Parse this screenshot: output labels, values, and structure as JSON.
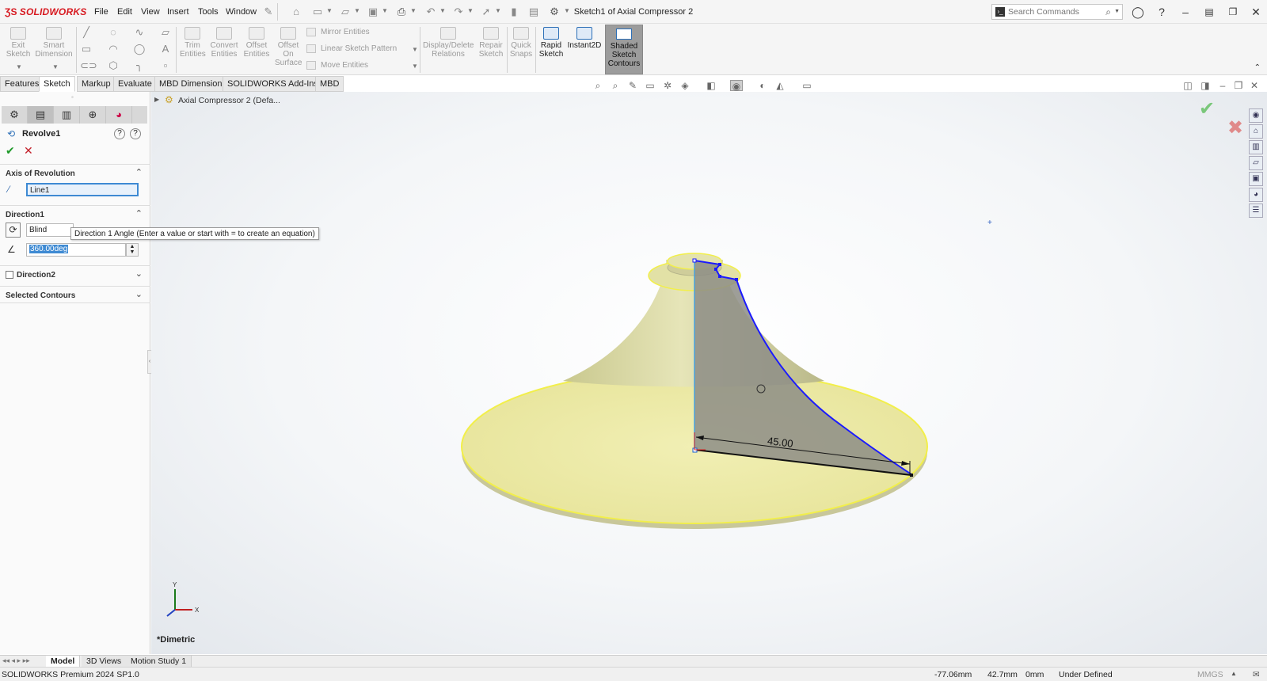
{
  "app": {
    "logo": "SOLIDWORKS",
    "document_title": "Sketch1 of Axial Compressor 2"
  },
  "menus": [
    "File",
    "Edit",
    "View",
    "Insert",
    "Tools",
    "Window"
  ],
  "search": {
    "placeholder": "Search Commands"
  },
  "toolbar": {
    "exit_sketch": "Exit Sketch",
    "smart_dimension": "Smart Dimension",
    "trim_entities": "Trim Entities",
    "convert_entities": "Convert Entities",
    "offset_entities": "Offset Entities",
    "offset_on_surface": "Offset On Surface",
    "mirror_entities": "Mirror Entities",
    "linear_sketch_pattern": "Linear Sketch Pattern",
    "move_entities": "Move Entities",
    "display_delete_relations": "Display/Delete Relations",
    "repair_sketch": "Repair Sketch",
    "quick_snaps": "Quick Snaps",
    "rapid_sketch": "Rapid Sketch",
    "instant2d": "Instant2D",
    "shaded_sketch_contours": "Shaded Sketch Contours"
  },
  "tabs": [
    "Features",
    "Sketch",
    "Markup",
    "Evaluate",
    "MBD Dimensions",
    "SOLIDWORKS Add-Ins",
    "MBD"
  ],
  "property_manager": {
    "title": "Revolve1",
    "axis_section": "Axis of Revolution",
    "axis_value": "Line1",
    "direction1_section": "Direction1",
    "end_condition": "Blind",
    "angle_value": "360.00deg",
    "tooltip": "Direction 1 Angle (Enter a value or start with = to create an equation)",
    "direction2_section": "Direction2",
    "selected_contours_section": "Selected Contours"
  },
  "tree": {
    "root": "Axial Compressor 2 (Defa..."
  },
  "viewport": {
    "dimension_label": "45.00",
    "view_name": "*Dimetric",
    "triad_x": "X",
    "triad_y": "Y"
  },
  "bottom_tabs": [
    "Model",
    "3D Views",
    "Motion Study 1"
  ],
  "status": {
    "version": "SOLIDWORKS Premium 2024 SP1.0",
    "x": "-77.06mm",
    "y": "42.7mm",
    "z": "0mm",
    "state": "Under Defined",
    "units": "MMGS"
  },
  "colors": {
    "accent": "#2c6fb7",
    "brand": "#d71920",
    "sketch_blue": "#1a1aff",
    "selection_yellow": "#f0f06a"
  }
}
